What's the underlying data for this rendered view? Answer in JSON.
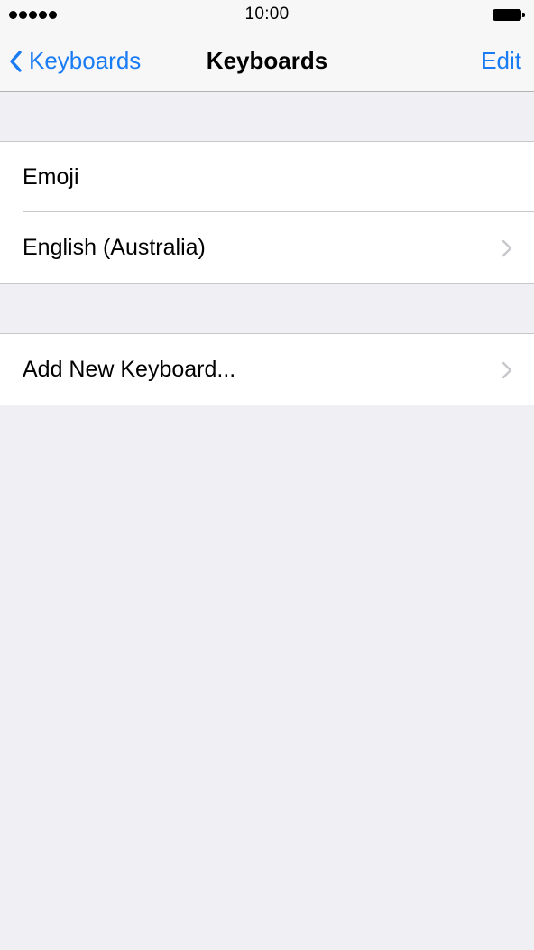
{
  "status_bar": {
    "signal_icon": "signal-dots-icon",
    "time": "10:00",
    "battery_icon": "battery-icon"
  },
  "nav_bar": {
    "back_label": "Keyboards",
    "back_icon": "chevron-left-icon",
    "title": "Keyboards",
    "edit_label": "Edit"
  },
  "keyboards": [
    {
      "label": "Emoji",
      "has_chevron": false
    },
    {
      "label": "English (Australia)",
      "has_chevron": true
    }
  ],
  "add_section": {
    "label": "Add New Keyboard...",
    "has_chevron": true
  },
  "colors": {
    "accent": "#1a7cf5",
    "background": "#efeff4",
    "separator": "#c8c7cc",
    "chevron": "#c7c7cc"
  }
}
